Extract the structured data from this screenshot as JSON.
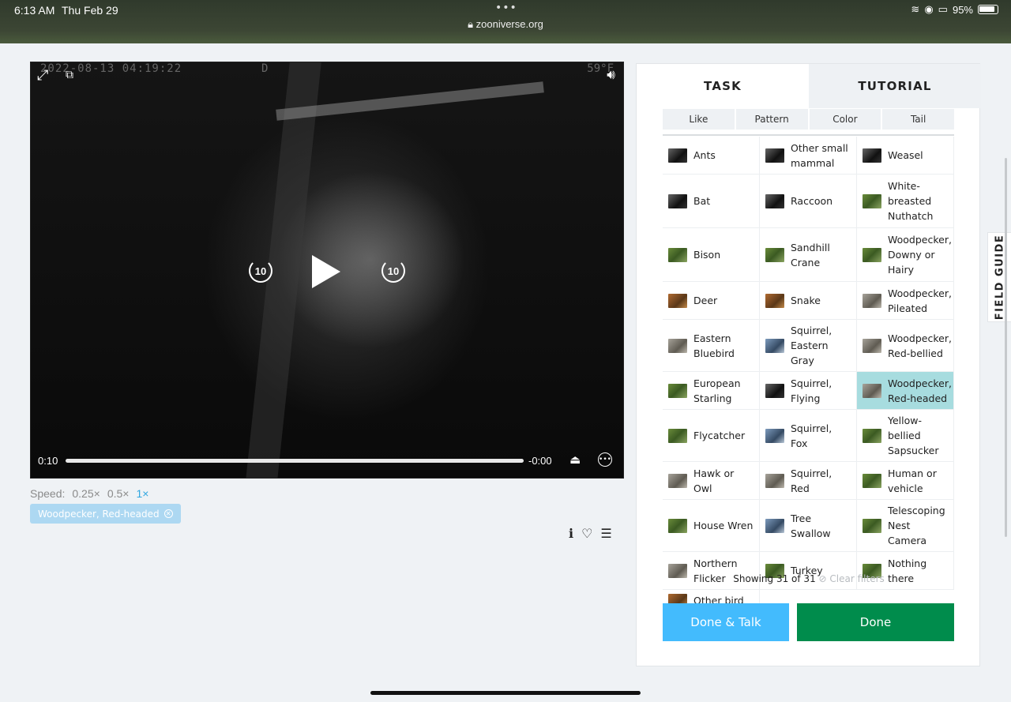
{
  "status_bar": {
    "time": "6:13 AM",
    "date": "Thu Feb 29",
    "battery": "95%",
    "url": "zooniverse.org"
  },
  "video": {
    "timestamp": "2022-08-13 04:19:22",
    "overlay_letter": "D",
    "temperature": "59°F",
    "skip_back": "10",
    "skip_forward": "10",
    "current_time": "0:10",
    "remaining_time": "-0:00",
    "progress": 1.0
  },
  "speed": {
    "label": "Speed:",
    "options": [
      "0.25×",
      "0.5×",
      "1×"
    ],
    "selected": "1×"
  },
  "selected_chip": "Woodpecker, Red-headed",
  "panel": {
    "tabs": [
      "TASK",
      "TUTORIAL"
    ],
    "filters": [
      "Like",
      "Pattern",
      "Color",
      "Tail"
    ],
    "choices": [
      {
        "label": "Ants",
        "thumb": "dark"
      },
      {
        "label": "Other small mammal",
        "thumb": "dark"
      },
      {
        "label": "Weasel",
        "thumb": "dark"
      },
      {
        "label": "Bat",
        "thumb": "dark"
      },
      {
        "label": "Raccoon",
        "thumb": "dark"
      },
      {
        "label": "White-breasted Nuthatch",
        "thumb": "green"
      },
      {
        "label": "Bison",
        "thumb": "green"
      },
      {
        "label": "Sandhill Crane",
        "thumb": "green"
      },
      {
        "label": "Woodpecker, Downy or Hairy",
        "thumb": "green"
      },
      {
        "label": "Deer",
        "thumb": "brown"
      },
      {
        "label": "Snake",
        "thumb": "brown"
      },
      {
        "label": "Woodpecker, Pileated",
        "thumb": "grey"
      },
      {
        "label": "Eastern Bluebird",
        "thumb": "grey"
      },
      {
        "label": "Squirrel, Eastern Gray",
        "thumb": "blue"
      },
      {
        "label": "Woodpecker, Red-bellied",
        "thumb": "grey"
      },
      {
        "label": "European Starling",
        "thumb": "green"
      },
      {
        "label": "Squirrel, Flying",
        "thumb": "dark"
      },
      {
        "label": "Woodpecker, Red-headed",
        "thumb": "grey",
        "selected": true
      },
      {
        "label": "Flycatcher",
        "thumb": "green"
      },
      {
        "label": "Squirrel, Fox",
        "thumb": "blue"
      },
      {
        "label": "Yellow-bellied Sapsucker",
        "thumb": "green"
      },
      {
        "label": "Hawk or Owl",
        "thumb": "grey"
      },
      {
        "label": "Squirrel, Red",
        "thumb": "grey"
      },
      {
        "label": "Human or vehicle",
        "thumb": "green"
      },
      {
        "label": "House Wren",
        "thumb": "green"
      },
      {
        "label": "Tree Swallow",
        "thumb": "blue"
      },
      {
        "label": "Telescoping Nest Camera",
        "thumb": "green"
      },
      {
        "label": "Northern Flicker",
        "thumb": "grey"
      },
      {
        "label": "Turkey",
        "thumb": "green"
      },
      {
        "label": "Nothing there",
        "thumb": "green"
      },
      {
        "label": "Other bird",
        "thumb": "brown"
      }
    ],
    "showing_text": "Showing 31 of 31",
    "clear_filters": "Clear filters",
    "done_talk": "Done & Talk",
    "done": "Done"
  },
  "field_guide": "FIELD GUIDE",
  "colors": {
    "accent_blue": "#43bbfd",
    "done_green": "#008c4c",
    "selected_cell": "#a7dcdf",
    "speed_active": "#2fa6e0"
  }
}
